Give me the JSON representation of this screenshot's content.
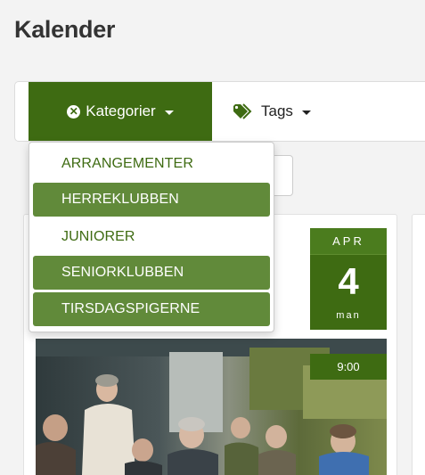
{
  "page": {
    "title": "Kalender"
  },
  "filters": {
    "category_label": "Kategorier",
    "tags_label": "Tags",
    "category_options": [
      {
        "label": "ARRANGEMENTER",
        "selected": false
      },
      {
        "label": "HERREKLUBBEN",
        "selected": true
      },
      {
        "label": "JUNIORER",
        "selected": false
      },
      {
        "label": "SENIORKLUBBEN",
        "selected": true
      },
      {
        "label": "TIRSDAGSPIGERNE",
        "selected": true
      }
    ]
  },
  "event": {
    "month": "APR",
    "day": "4",
    "weekday": "man",
    "time": "9:00"
  },
  "colors": {
    "primary_green": "#3e6b12",
    "selected_item": "#618a3a"
  }
}
